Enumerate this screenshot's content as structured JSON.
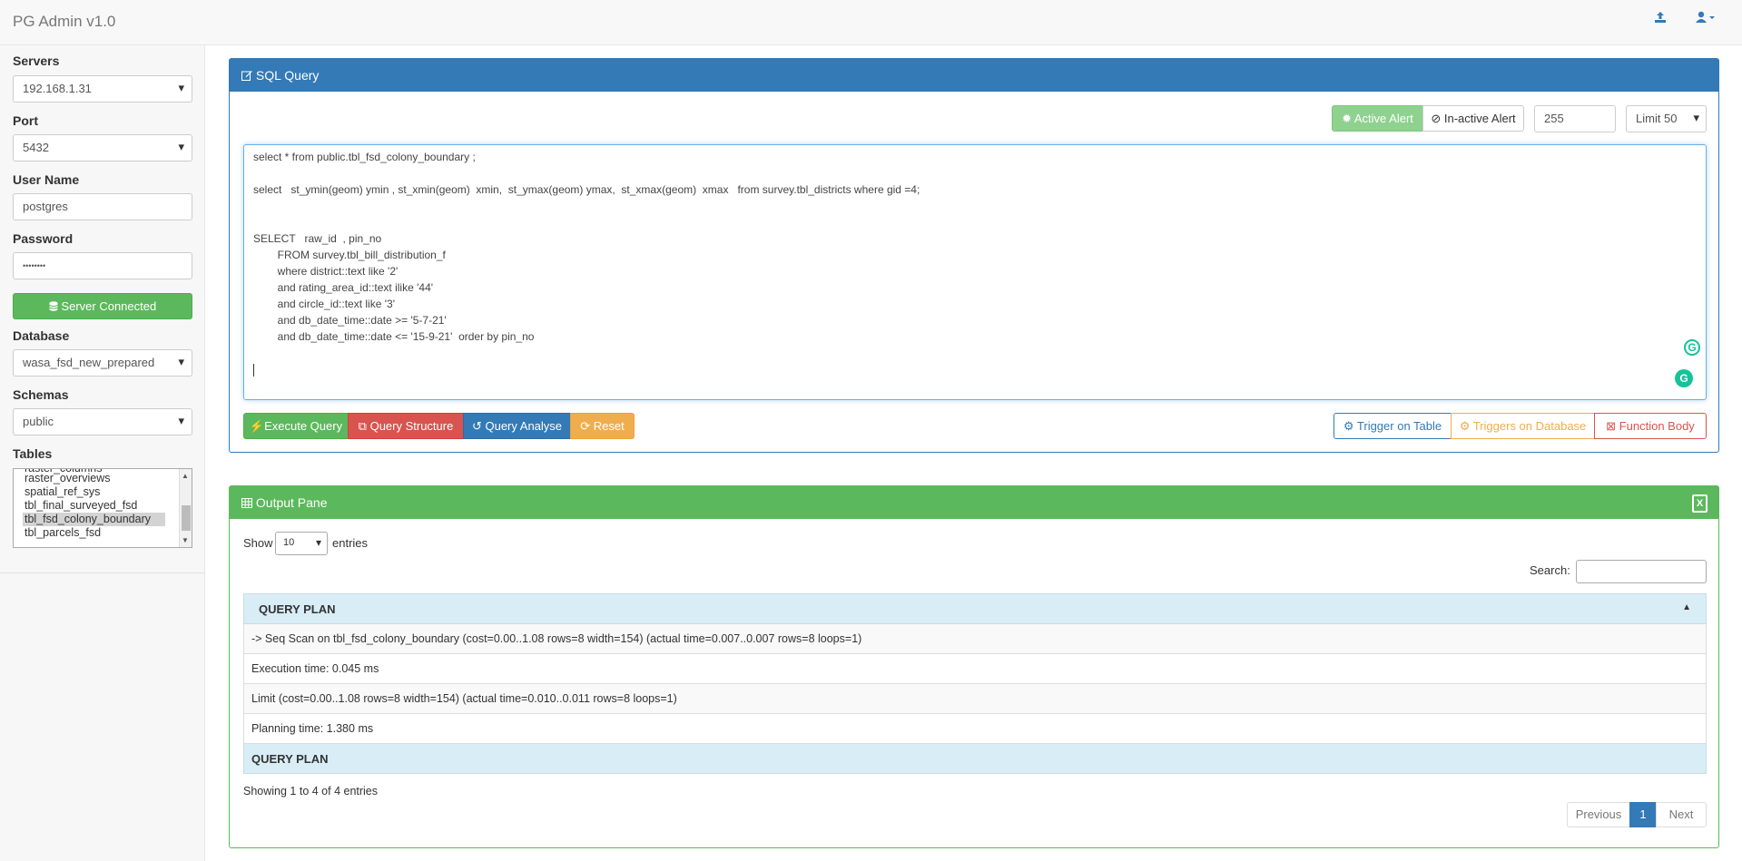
{
  "app": {
    "title": "PG Admin v1.0"
  },
  "nav": {
    "upload_icon": "upload-icon",
    "user_icon": "user-icon"
  },
  "sidebar": {
    "servers_label": "Servers",
    "server_value": "192.168.1.31",
    "port_label": "Port",
    "port_value": "5432",
    "username_label": "User Name",
    "username_value": "postgres",
    "password_label": "Password",
    "password_value": "••••••••",
    "connected_label": "Server Connected",
    "database_label": "Database",
    "database_value": "wasa_fsd_new_prepared",
    "schemas_label": "Schemas",
    "schema_value": "public",
    "tables_label": "Tables",
    "tables": [
      "raster_columns",
      "raster_overviews",
      "spatial_ref_sys",
      "tbl_final_surveyed_fsd",
      "tbl_fsd_colony_boundary",
      "tbl_parcels_fsd"
    ],
    "selected_table": "tbl_fsd_colony_boundary"
  },
  "sql_panel": {
    "title": "SQL Query",
    "active_alert_label": "Active Alert",
    "inactive_alert_label": "In-active Alert",
    "number_value": "255",
    "limit_value": "Limit 50",
    "query_lines": [
      "select * from public.tbl_fsd_colony_boundary ;",
      "",
      "select   st_ymin(geom) ymin , st_xmin(geom)  xmin,  st_ymax(geom) ymax,  st_xmax(geom)  xmax   from survey.tbl_districts where gid =4;",
      "",
      "",
      "SELECT   raw_id  , pin_no",
      "        FROM survey.tbl_bill_distribution_f",
      "        where district::text like '2'",
      "        and rating_area_id::text ilike '44'",
      "        and circle_id::text like '3'",
      "        and db_date_time::date >= '5-7-21'",
      "        and db_date_time::date <= '15-9-21'  order by pin_no"
    ],
    "execute_label": "Execute Query",
    "structure_label": "Query Structure",
    "analyse_label": "Query Analyse",
    "reset_label": "Reset",
    "trigger_table_label": "Trigger on Table",
    "trigger_db_label": "Triggers on Database",
    "function_body_label": "Function Body"
  },
  "output_panel": {
    "title": "Output Pane",
    "show_label": "Show",
    "entries_value": "10",
    "entries_label": "entries",
    "search_label": "Search:",
    "column_header": "QUERY PLAN",
    "rows": [
      "-> Seq Scan on tbl_fsd_colony_boundary (cost=0.00..1.08 rows=8 width=154) (actual time=0.007..0.007 rows=8 loops=1)",
      "Execution time: 0.045 ms",
      "Limit (cost=0.00..1.08 rows=8 width=154) (actual time=0.010..0.011 rows=8 loops=1)",
      "Planning time: 1.380 ms"
    ],
    "footer_header": "QUERY PLAN",
    "info": "Showing 1 to 4 of 4 entries",
    "prev_label": "Previous",
    "page": "1",
    "next_label": "Next"
  }
}
